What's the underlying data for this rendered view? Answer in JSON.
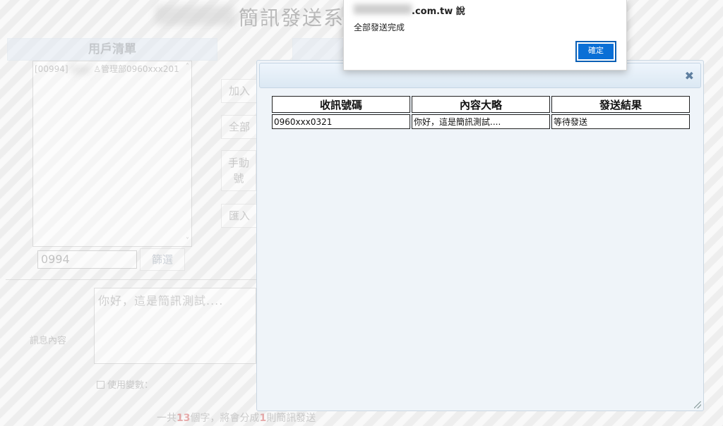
{
  "page": {
    "title": "簡訊發送系"
  },
  "sections": {
    "user_list": "用戶清單"
  },
  "user_list": {
    "items": [
      {
        "label": "[00994]",
        "suffix": "管理部0960xxx201"
      }
    ]
  },
  "side_buttons": {
    "add": "加入",
    "all": "全部",
    "manual_line1": "手動",
    "manual_line2": "號",
    "import": "匯入"
  },
  "filter": {
    "value": "0994",
    "button": "篩選"
  },
  "message": {
    "label": "訊息內容",
    "text": "你好，這是簡訊測試...."
  },
  "variables": {
    "label": "使用變數："
  },
  "counter": {
    "prefix": "一共",
    "chars": "13",
    "mid": "個字，將會分成",
    "parts": "1",
    "suffix": "則簡訊發送"
  },
  "modal": {
    "headers": [
      "收訊號碼",
      "內容大略",
      "發送結果"
    ],
    "rows": [
      [
        "0960xxx0321",
        "你好，這是簡訊測試....",
        "等待發送"
      ]
    ]
  },
  "alert": {
    "origin": ".com.tw 說",
    "message": "全部發送完成",
    "ok": "確定"
  },
  "colors": {
    "accent": "#0a6fd6",
    "count_highlight": "#d86c6c"
  }
}
